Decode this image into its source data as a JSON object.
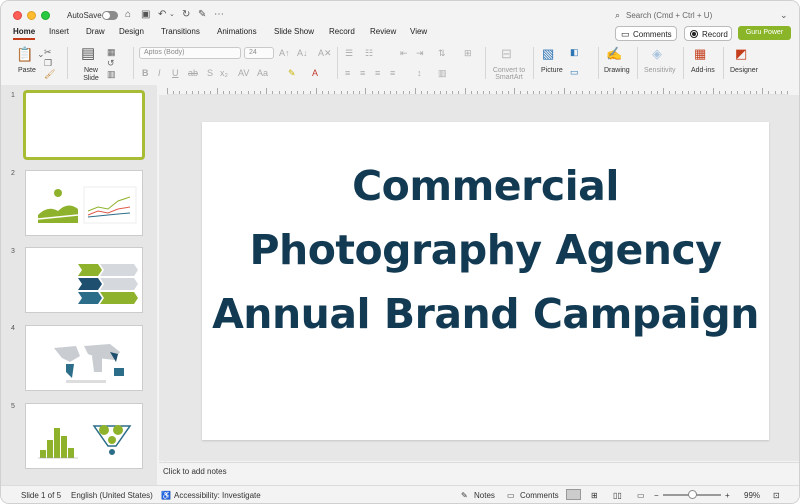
{
  "app": {
    "autosave_label": "AutoSave",
    "search_label": "Search (Cmd + Ctrl + U)"
  },
  "tabs": [
    "Home",
    "Insert",
    "Draw",
    "Design",
    "Transitions",
    "Animations",
    "Slide Show",
    "Record",
    "Review",
    "View"
  ],
  "active_tab": "Home",
  "header_buttons": {
    "comments": "Comments",
    "record": "Record",
    "guru": "Guru Power"
  },
  "ribbon": {
    "paste": "Paste",
    "new_slide": "New Slide",
    "font_name": "Aptos (Body)",
    "font_size": "24",
    "convert_smartart": "Convert to SmartArt",
    "picture": "Picture",
    "drawing": "Drawing",
    "sensitivity": "Sensitivity",
    "addins": "Add-ins",
    "designer": "Designer"
  },
  "colors": {
    "accent": "#c43e1c",
    "guru": "#8ab528",
    "title_text": "#123a52",
    "thumb_selected": "#a9bc36"
  },
  "slides": {
    "numbers": [
      "1",
      "2",
      "3",
      "4",
      "5"
    ],
    "selected_index": 0
  },
  "slide": {
    "title": "Commercial Photography Agency Annual Brand Campaign"
  },
  "notes": {
    "placeholder": "Click to add notes"
  },
  "status": {
    "slide_counter": "Slide 1 of 5",
    "language": "English (United States)",
    "accessibility": "Accessibility: Investigate",
    "notes": "Notes",
    "comments": "Comments",
    "zoom": "99%"
  }
}
